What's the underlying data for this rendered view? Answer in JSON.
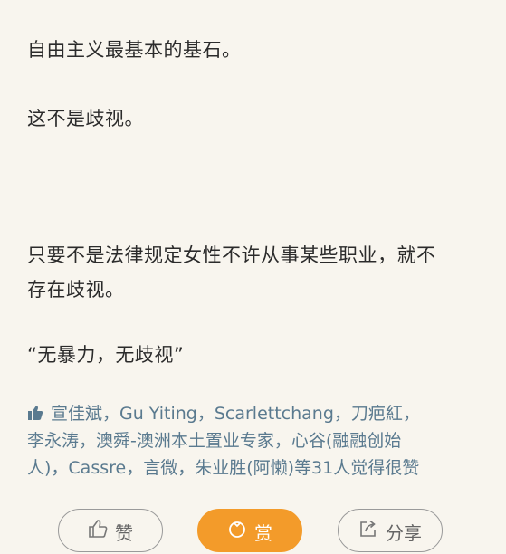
{
  "paragraphs": [
    "自由主义最基本的基石。",
    "这不是歧视。",
    "只要不是法律规定女性不许从事某些职业，就不",
    "存在歧视。",
    "“无暴力，无歧视”"
  ],
  "likes": {
    "names_line1": "宣佳斌，Gu Yiting，Scarlettchang，刀疤紅，",
    "names_line2": "李永涛，澳舜-澳洲本土置业专家，心谷(融融创始",
    "names_line3": "人)，Cassre，言微，朱业胜(阿懒)",
    "suffix": "等31人觉得很赞",
    "link_color": "#5a7a8f"
  },
  "actions": {
    "like_label": "赞",
    "reward_label": "赏",
    "share_label": "分享",
    "reward_color": "#f39b2a"
  }
}
